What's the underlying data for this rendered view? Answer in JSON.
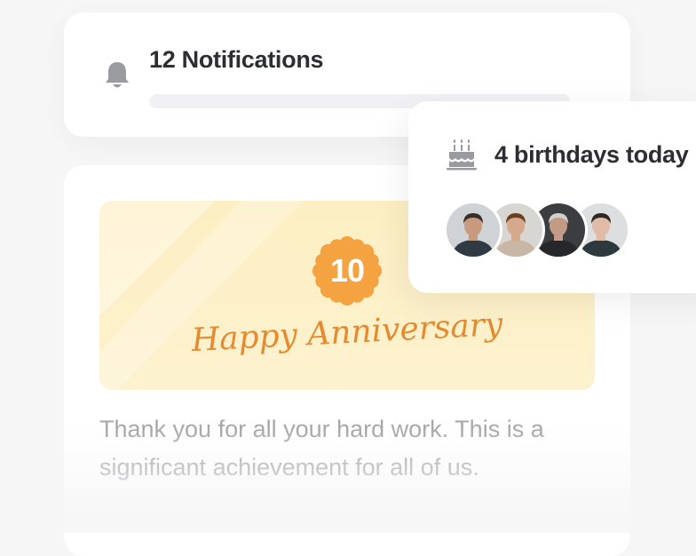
{
  "notifications": {
    "title": "12 Notifications",
    "icon": "bell-icon"
  },
  "birthdays": {
    "title": "4 birthdays today",
    "icon": "cake-icon",
    "avatars": [
      {
        "name": "avatar-1",
        "bg": "#cfd3d6",
        "skin": "#c99b7e",
        "hair": "#3a2e28",
        "shirt": "#2f3a44"
      },
      {
        "name": "avatar-2",
        "bg": "#d8d6d2",
        "skin": "#d5a98c",
        "hair": "#6b3f23",
        "shirt": "#c9b7a6"
      },
      {
        "name": "avatar-3",
        "bg": "#3b3d40",
        "skin": "#c39a86",
        "hair": "#d3d0cc",
        "shirt": "#25272a"
      },
      {
        "name": "avatar-4",
        "bg": "#dcdedf",
        "skin": "#e0bca8",
        "hair": "#2e2722",
        "shirt": "#2c3a3d"
      }
    ]
  },
  "anniversary": {
    "badge_number": "10",
    "title": "Happy Anniversary",
    "message": "Thank you for all your hard work. This is a significant achievement for all of us."
  },
  "colors": {
    "accent_orange": "#e58a2e",
    "badge_orange": "#f4a340",
    "banner_yellow": "#fdefc3",
    "text_dark": "#2d2e34",
    "text_muted": "#a6a7ab",
    "icon_gray": "#9a9ba0"
  }
}
